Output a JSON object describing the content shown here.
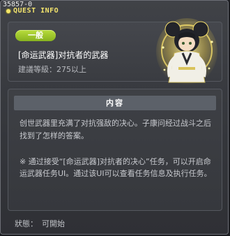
{
  "window": {
    "quest_id": "35857-0",
    "title": "QUEST INFO",
    "close_label": "×"
  },
  "header": {
    "badge": "一般",
    "quest_name": "[命运武器]对抗者的武器",
    "level_label": "建議等級：",
    "level_value": "275以上"
  },
  "content": {
    "heading": "内容",
    "description": "创世武器里充满了对抗强敌的决心。子康问经过战斗之后找到了怎样的答案。",
    "note": "※ 通过接受“[命运武器]对抗者的决心”任务，可以开启命运武器任务UI。通过该UI可以查看任务信息及执行任务。"
  },
  "status": {
    "label": "狀態：",
    "value": "可開始"
  },
  "colors": {
    "accent_yellow": "#f2e36c",
    "badge_green": "#9cc82c",
    "panel_bg": "#3a3c41"
  }
}
